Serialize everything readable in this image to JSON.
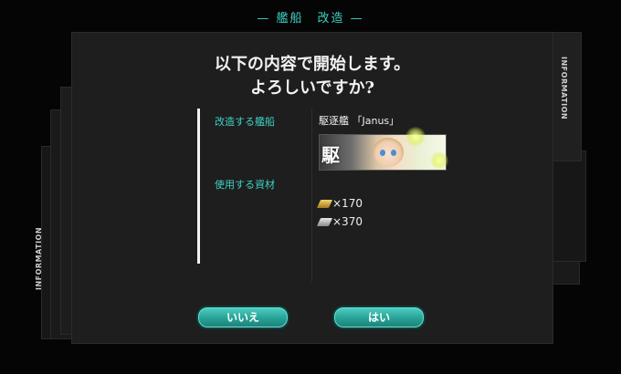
{
  "header": {
    "title": "— 艦船　改造 —"
  },
  "side_tabs": {
    "left": "INFORMATION",
    "right": "INFORMATION"
  },
  "dialog": {
    "question_line1": "以下の内容で開始します。",
    "question_line2": "よろしいですか?",
    "ship_label": "改造する艦船",
    "ship_name": "駆逐艦 「Janus」",
    "banner_kanji": "駆",
    "resource_label": "使用する資材",
    "resources": [
      {
        "icon": "ammo-icon",
        "text": "×170"
      },
      {
        "icon": "steel-icon",
        "text": "×370"
      }
    ],
    "no_button": "いいえ",
    "yes_button": "はい"
  },
  "colors": {
    "accent": "#3fd1c4",
    "button": "#2aa59a",
    "panel": "#1e1e1e"
  }
}
